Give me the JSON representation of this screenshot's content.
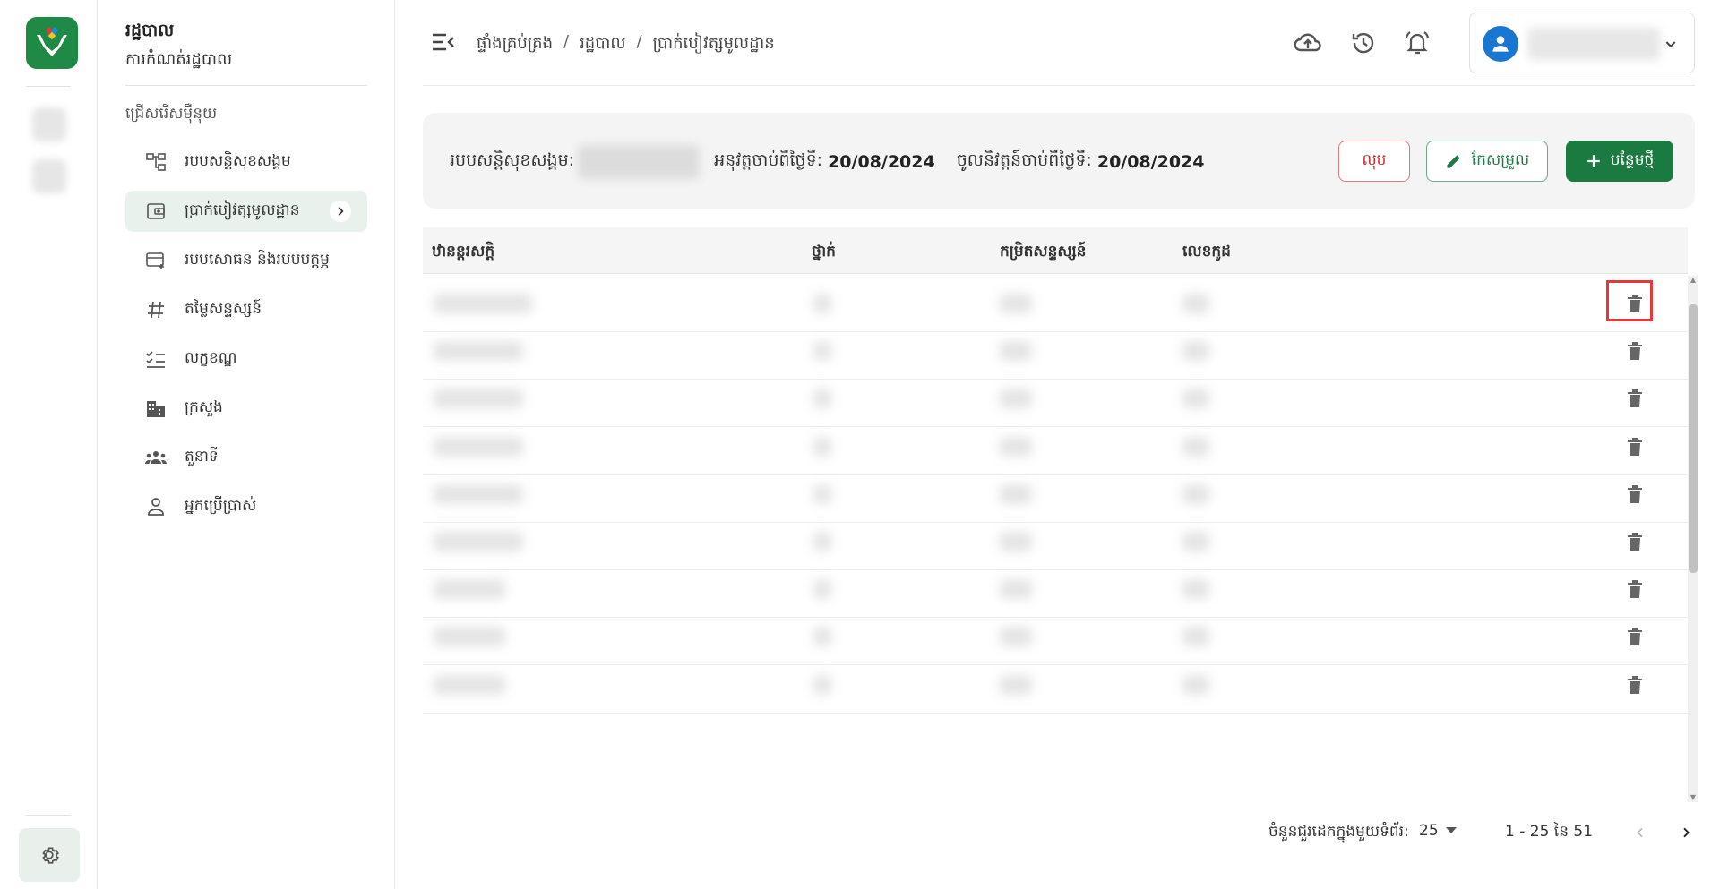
{
  "sidemenu": {
    "title": "រដ្ឋបាល",
    "subtitle": "ការកំណត់រដ្ឋបាល",
    "section_label": "ជ្រើសរើសម៉ឺនុយ",
    "items": [
      {
        "label": "របបសន្តិសុខសង្គម",
        "icon": "hierarchy-icon"
      },
      {
        "label": "ប្រាក់បៀវត្សមូលដ្ឋាន",
        "icon": "wallet-icon",
        "active": true
      },
      {
        "label": "របបសោធន និងរបបបត្តម្ភ",
        "icon": "credit-card-add-icon"
      },
      {
        "label": "តម្លៃសន្ទស្សន៍",
        "icon": "hash-icon"
      },
      {
        "label": "លក្ខខណ្ឌ",
        "icon": "checklist-icon"
      },
      {
        "label": "ក្រសួង",
        "icon": "building-icon"
      },
      {
        "label": "តួនាទី",
        "icon": "group-icon"
      },
      {
        "label": "អ្នកប្រើប្រាស់",
        "icon": "person-icon"
      }
    ]
  },
  "header": {
    "breadcrumb": [
      "ផ្ទាំងគ្រប់គ្រង",
      "រដ្ឋបាល",
      "ប្រាក់បៀវត្សមូលដ្ឋាន"
    ],
    "breadcrumb_separator": "/"
  },
  "info": {
    "scheme_label": "របបសន្តិសុខសង្គម:",
    "effective_label": "អនុវត្តចាប់ពីថ្ងៃទី:",
    "effective_date": "20/08/2024",
    "enforce_label": "ចូលនិវត្តន៍ចាប់ពីថ្ងៃទី:",
    "enforce_date": "20/08/2024",
    "delete_label": "លុប",
    "edit_label": "កែសម្រួល",
    "add_label": "បន្ថែមថ្មី"
  },
  "table": {
    "columns": [
      "ឋានន្តរសក្តិ",
      "ថ្នាក់",
      "កម្រិតសន្ទស្សន៍",
      "លេខកូដ"
    ],
    "row_count": 9
  },
  "pager": {
    "rows_per_page_label": "ចំនួនជួរដេកក្នុងមួយទំព័រ:",
    "rows_per_page": "25",
    "range": "1 - 25 នៃ 51"
  },
  "colors": {
    "brand": "#1a7a3f",
    "danger": "#c62828",
    "avatar": "#1976d2",
    "highlight": "#e53935"
  }
}
